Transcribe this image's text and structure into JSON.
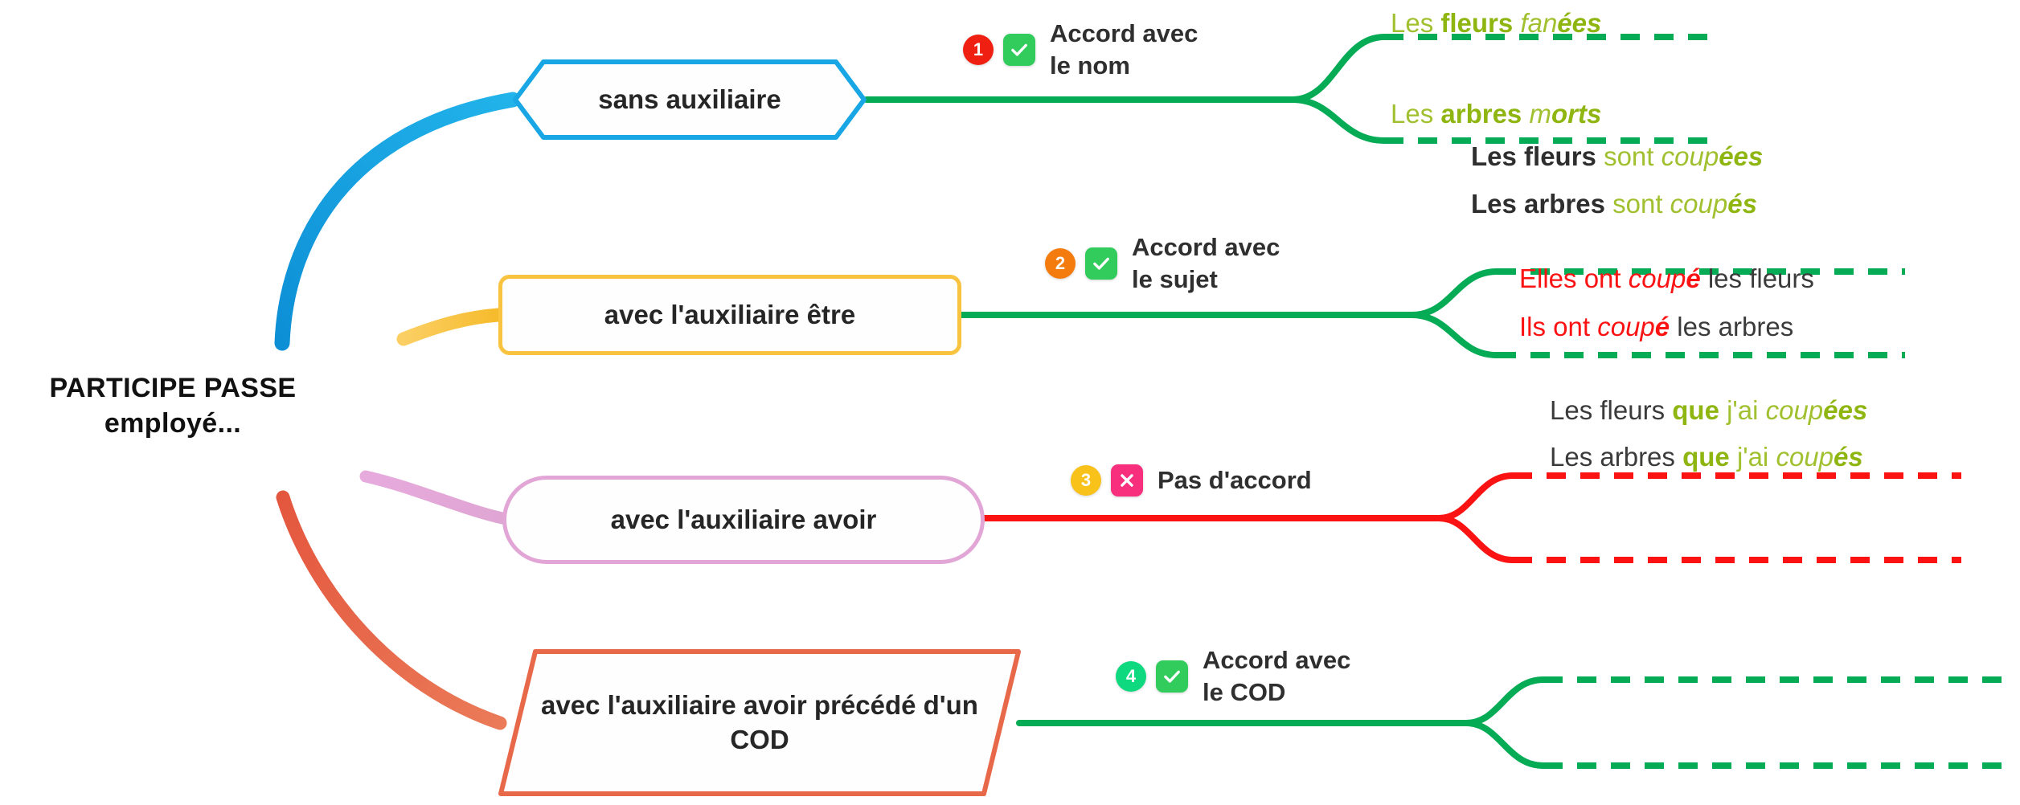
{
  "root": {
    "line1": "PARTICIPE PASSE",
    "line2": "employé..."
  },
  "colors": {
    "branch1": "#19a6e4",
    "branch2": "#f8c33f",
    "branch3": "#e2a6d6",
    "branch4": "#e8694a",
    "agree_green": "#05ab55",
    "disagree_red": "#fb1313",
    "olive": "#a1c02f",
    "dark_text": "#3b3b3b"
  },
  "branches": [
    {
      "id": "sans-auxiliaire",
      "node_label": "sans auxiliaire",
      "shape": "hexagon",
      "badge": {
        "number": "1",
        "color": "#ef2012"
      },
      "mark": {
        "icon": "check-icon",
        "color": "#32cc5d"
      },
      "rule_caption": "Accord avec\nle nom",
      "rule_type": "accord",
      "examples": [
        {
          "parts": [
            {
              "text": "Les ",
              "style": "olive"
            },
            {
              "text": "fleurs ",
              "style": "olive-b"
            },
            {
              "text": "fan",
              "style": "olive-i"
            },
            {
              "text": "ées",
              "style": "olive-bi"
            }
          ]
        },
        {
          "parts": [
            {
              "text": "Les ",
              "style": "olive"
            },
            {
              "text": "arbres ",
              "style": "olive-b"
            },
            {
              "text": "m",
              "style": "olive-i"
            },
            {
              "text": "orts",
              "style": "olive-bi"
            }
          ]
        }
      ]
    },
    {
      "id": "auxiliaire-etre",
      "node_label": "avec l'auxiliaire être",
      "shape": "rounded-rect",
      "badge": {
        "number": "2",
        "color": "#f47c0e"
      },
      "mark": {
        "icon": "check-icon",
        "color": "#32cc5d"
      },
      "rule_caption": "Accord avec\nle sujet",
      "rule_type": "accord",
      "examples": [
        {
          "parts": [
            {
              "text": "Les fleurs ",
              "style": "dark-b"
            },
            {
              "text": "sont ",
              "style": "olive"
            },
            {
              "text": "coup",
              "style": "olive-i"
            },
            {
              "text": "ées",
              "style": "olive-bi"
            }
          ]
        },
        {
          "parts": [
            {
              "text": "Les arbres ",
              "style": "dark-b"
            },
            {
              "text": "sont ",
              "style": "olive"
            },
            {
              "text": "coup",
              "style": "olive-i"
            },
            {
              "text": "és",
              "style": "olive-bi"
            }
          ]
        }
      ]
    },
    {
      "id": "auxiliaire-avoir",
      "node_label": "avec l'auxiliaire avoir",
      "shape": "pill",
      "badge": {
        "number": "3",
        "color": "#f9c21a"
      },
      "mark": {
        "icon": "cross-icon",
        "color": "#f72f7d"
      },
      "rule_caption": "Pas d'accord",
      "rule_type": "pas-accord",
      "examples": [
        {
          "parts": [
            {
              "text": "Elles ont ",
              "style": "red"
            },
            {
              "text": "coup",
              "style": "red-i"
            },
            {
              "text": "é",
              "style": "red-bi"
            },
            {
              "text": " les fleurs",
              "style": "dark"
            }
          ]
        },
        {
          "parts": [
            {
              "text": "Ils ont ",
              "style": "red"
            },
            {
              "text": "coup",
              "style": "red-i"
            },
            {
              "text": "é",
              "style": "red-bi"
            },
            {
              "text": " les arbres",
              "style": "dark"
            }
          ]
        }
      ]
    },
    {
      "id": "auxiliaire-avoir-cod",
      "node_label": "avec l'auxiliaire avoir\nprécédé d'un COD",
      "shape": "parallelogram",
      "badge": {
        "number": "4",
        "color": "#0ed97f"
      },
      "mark": {
        "icon": "check-icon",
        "color": "#32cc5d"
      },
      "rule_caption": "Accord avec\nle COD",
      "rule_type": "accord",
      "examples": [
        {
          "parts": [
            {
              "text": "Les fleurs ",
              "style": "dark"
            },
            {
              "text": "que ",
              "style": "olive-b"
            },
            {
              "text": "j'ai ",
              "style": "olive"
            },
            {
              "text": "coup",
              "style": "olive-i"
            },
            {
              "text": "ées",
              "style": "olive-bi"
            }
          ]
        },
        {
          "parts": [
            {
              "text": "Les arbres ",
              "style": "dark"
            },
            {
              "text": "que ",
              "style": "olive-b"
            },
            {
              "text": "j'ai ",
              "style": "olive"
            },
            {
              "text": "coup",
              "style": "olive-i"
            },
            {
              "text": "és",
              "style": "olive-bi"
            }
          ]
        }
      ]
    }
  ]
}
